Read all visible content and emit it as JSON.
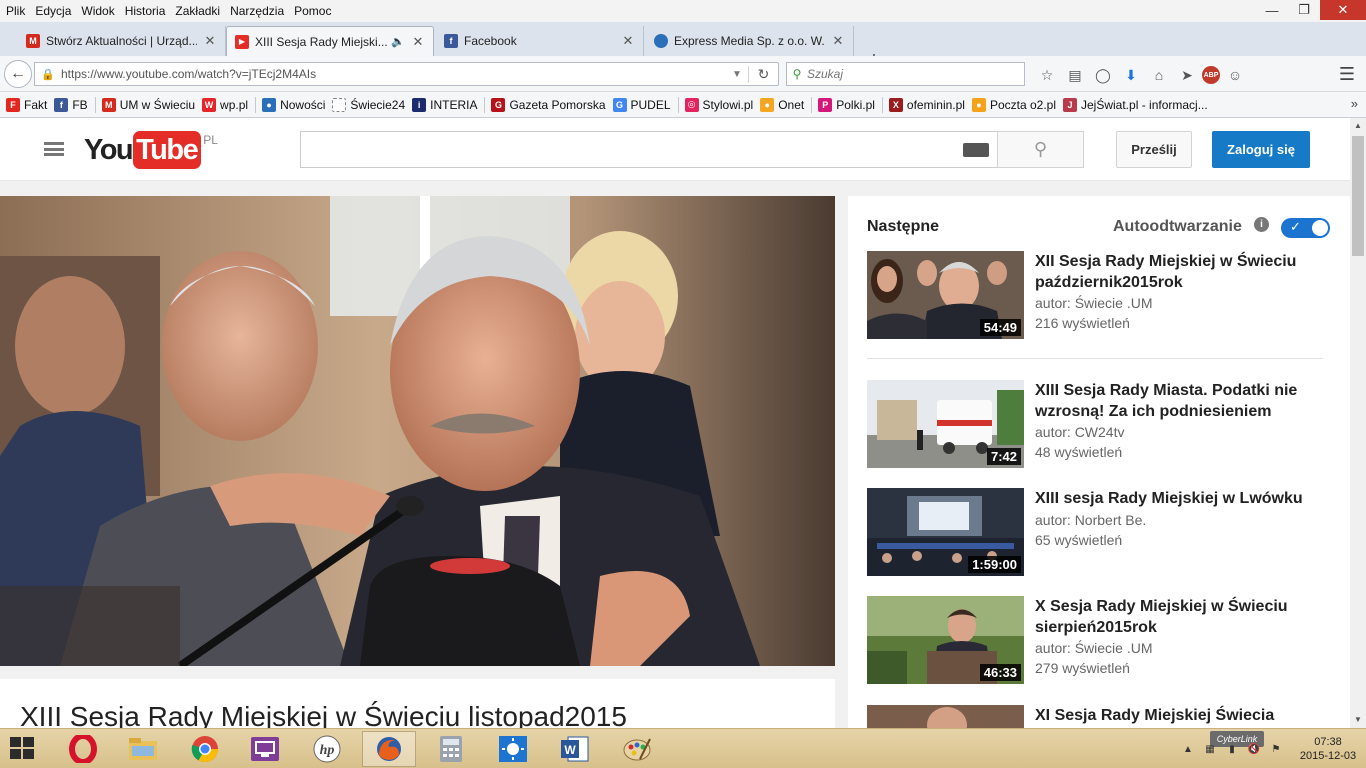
{
  "menubar": {
    "items": [
      "Plik",
      "Edycja",
      "Widok",
      "Historia",
      "Zakładki",
      "Narzędzia",
      "Pomoc"
    ]
  },
  "tabs": [
    {
      "title": "Stwórz Aktualności | Urząd...",
      "icon": "um-swiecie-favicon",
      "active": false
    },
    {
      "title": "XIII Sesja Rady Miejski...",
      "icon": "youtube-favicon",
      "active": true,
      "audio": true
    },
    {
      "title": "Facebook",
      "icon": "facebook-favicon",
      "active": false
    },
    {
      "title": "Express Media Sp. z o.o. W...",
      "icon": "globe-favicon",
      "active": false
    }
  ],
  "navbar": {
    "url": "https://www.youtube.com/watch?v=jTEcj2M4AIs",
    "search_placeholder": "Szukaj"
  },
  "bookmarks": [
    {
      "label": "Fakt",
      "icon": "fakt-icon",
      "color": "#e3261e",
      "glyph": "F"
    },
    {
      "label": "FB",
      "icon": "facebook-icon",
      "color": "#3b5998",
      "glyph": "f"
    },
    {
      "label": "UM w Świeciu",
      "icon": "um-icon",
      "color": "#d42a1e",
      "glyph": "M"
    },
    {
      "label": "wp.pl",
      "icon": "wp-icon",
      "color": "#e4262b",
      "glyph": "W"
    },
    {
      "label": "Nowości",
      "icon": "globe-icon",
      "color": "#2a6fb8",
      "glyph": "●"
    },
    {
      "label": "Świecie24",
      "icon": "page-icon",
      "color": "#ffffff",
      "glyph": ""
    },
    {
      "label": "INTERIA",
      "icon": "interia-icon",
      "color": "#1c2a6e",
      "glyph": "i"
    },
    {
      "label": "Gazeta Pomorska",
      "icon": "gp-icon",
      "color": "#b5131c",
      "glyph": "G"
    },
    {
      "label": "PUDEL",
      "icon": "google-icon",
      "color": "#4285f4",
      "glyph": "G"
    },
    {
      "label": "Stylowi.pl",
      "icon": "stylowi-icon",
      "color": "#e3245f",
      "glyph": "◎"
    },
    {
      "label": "Onet",
      "icon": "onet-icon",
      "color": "#f5a623",
      "glyph": "●"
    },
    {
      "label": "Polki.pl",
      "icon": "polki-icon",
      "color": "#d6177a",
      "glyph": "P"
    },
    {
      "label": "ofeminin.pl",
      "icon": "ofeminin-icon",
      "color": "#9b1c1c",
      "glyph": "X"
    },
    {
      "label": "Poczta o2.pl",
      "icon": "o2-icon",
      "color": "#f7a21b",
      "glyph": "●"
    },
    {
      "label": "JejŚwiat.pl - informacj...",
      "icon": "jej-icon",
      "color": "#b83a4b",
      "glyph": "J"
    }
  ],
  "youtube": {
    "logo_you": "You",
    "logo_tube": "Tube",
    "logo_country": "PL",
    "upload_label": "Prześlij",
    "signin_label": "Zaloguj się",
    "video_title": "XIII Sesja Rady Miejskiej w Świeciu listopad2015",
    "sidebar": {
      "next_label": "Następne",
      "autoplay_label": "Autoodtwarzanie",
      "autoplay_on": true,
      "items": [
        {
          "title": "XII Sesja Rady Miejskiej w Świeciu październik2015rok",
          "author": "autor: Świecie .UM",
          "views": "216 wyświetleń",
          "duration": "54:49"
        },
        {
          "title": "XIII Sesja Rady Miasta. Podatki nie wzrosną! Za ich podniesieniem",
          "author": "autor: CW24tv",
          "views": "48 wyświetleń",
          "duration": "7:42"
        },
        {
          "title": "XIII sesja Rady Miejskiej w Lwówku",
          "author": "autor: Norbert Be.",
          "views": "65 wyświetleń",
          "duration": "1:59:00"
        },
        {
          "title": "X Sesja Rady Miejskiej w Świeciu sierpień2015rok",
          "author": "autor: Świecie .UM",
          "views": "279 wyświetleń",
          "duration": "46:33"
        },
        {
          "title": "XI Sesja Rady Miejskiej Świecia",
          "author": "",
          "views": "",
          "duration": ""
        }
      ]
    }
  },
  "taskbar": {
    "apps": [
      "opera",
      "file-explorer",
      "chrome",
      "remote-desktop",
      "hp",
      "firefox",
      "calculator",
      "brightness",
      "word",
      "paint"
    ],
    "active_app": "firefox",
    "tray_label": "CyberLink",
    "time": "07:38",
    "date": "2015-12-03"
  },
  "colors": {
    "youtube_red": "#e52d27",
    "signin_blue": "#167ac6",
    "toggle_blue": "#1b75d0"
  }
}
